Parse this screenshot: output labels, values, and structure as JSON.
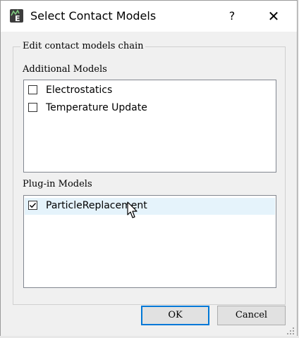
{
  "window": {
    "title": "Select Contact Models",
    "help_label": "?",
    "close_label": "✕"
  },
  "chain_group": {
    "title": "Edit contact models chain"
  },
  "additional": {
    "label": "Additional Models",
    "items": [
      {
        "label": "Electrostatics",
        "checked": false
      },
      {
        "label": "Temperature Update",
        "checked": false
      }
    ]
  },
  "plugin": {
    "label": "Plug-in Models",
    "items": [
      {
        "label": "ParticleReplacement",
        "checked": true,
        "selected": true
      }
    ]
  },
  "buttons": {
    "ok_label": "OK",
    "cancel_label": "Cancel"
  },
  "colors": {
    "accent": "#0078d7",
    "selection": "#e5f3fb"
  }
}
